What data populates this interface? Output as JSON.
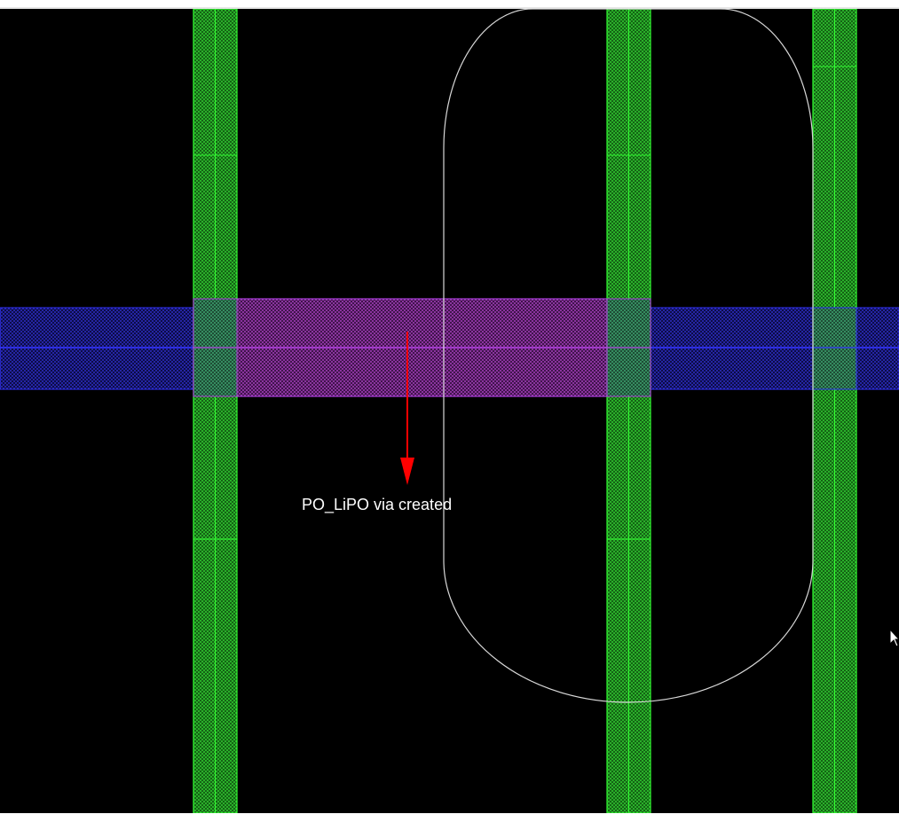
{
  "canvas": {
    "background_color": "#000000",
    "annotation": {
      "label": "PO_LiPO via created",
      "text_color": "#ffffff",
      "arrow_color": "#ff0000"
    },
    "layers": {
      "metal_vertical": {
        "icon": "green-hatched-rail",
        "fill_color": "#1f8f1f",
        "outline_color": "#33ff33"
      },
      "poly_horizontal": {
        "icon": "blue-hatched-rail",
        "fill_color": "#1a1a99",
        "outline_color": "#3333ff"
      },
      "via_region": {
        "icon": "magenta-hatched-via",
        "fill_color": "#8a2a9a",
        "outline_color": "#b040e0"
      },
      "boundary_outline": {
        "icon": "rounded-boundary-outline",
        "stroke_color": "#d8d8d8"
      }
    }
  },
  "cursor": {
    "icon": "arrow-cursor-icon"
  }
}
